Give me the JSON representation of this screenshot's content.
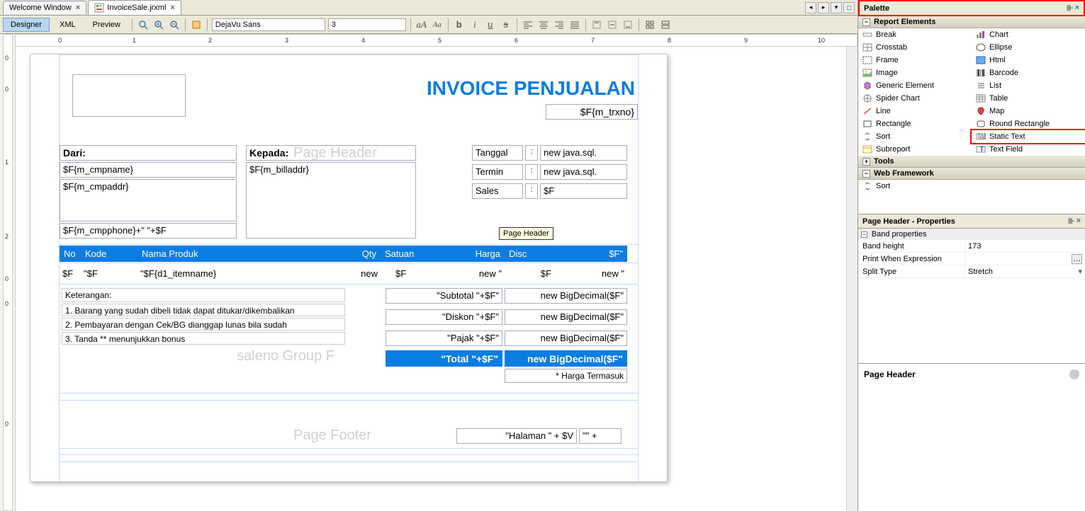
{
  "tabs": {
    "welcome": "Welcome Window",
    "file": "InvoiceSale.jrxml"
  },
  "toolbar": {
    "designer": "Designer",
    "xml": "XML",
    "preview": "Preview",
    "font": "DejaVu Sans",
    "size": "3"
  },
  "ruler": {
    "h": [
      "0",
      "1",
      "2",
      "3",
      "4",
      "5",
      "6",
      "7",
      "8",
      "9",
      "10"
    ],
    "v": [
      "0",
      "0",
      "1",
      "2",
      "0",
      "0",
      "0"
    ]
  },
  "report": {
    "title": "INVOICE PENJUALAN",
    "trxno": "$F{m_trxno}",
    "dari": "Dari:",
    "kepada": "Kepada:",
    "cmpname": "$F{m_cmpname}",
    "cmpaddr": "$F{m_cmpaddr}",
    "cmpphone": "$F{m_cmpphone}+\" \"+$F",
    "billaddr": "$F{m_billaddr}",
    "meta": {
      "tanggal_l": "Tanggal",
      "tanggal_v": "new java.sql.",
      "termin_l": "Termin",
      "termin_v": "new java.sql.",
      "sales_l": "Sales",
      "sales_v": "$F",
      "colon": ":"
    },
    "cols": {
      "no": "No",
      "kode": "Kode",
      "nama": "Nama Produk",
      "qty": "Qty",
      "satuan": "Satuan",
      "harga": "Harga",
      "disc": "Disc",
      "end": "$F\""
    },
    "row": {
      "no": "$F",
      "kode": "\"$F",
      "nama": "\"$F{d1_itemname}",
      "qty": "new",
      "satuan": "$F",
      "harga": "new \"",
      "disc": "$F",
      "end": "new \""
    },
    "keterangan": "Keterangan:",
    "notes": [
      "1. Barang yang sudah dibeli tidak dapat ditukar/dikembalikan",
      "2. Pembayaran dengan Cek/BG dianggap lunas bila sudah",
      "3. Tanda ** menunjukkan bonus"
    ],
    "sums": {
      "subtotal_l": "\"Subtotal \"+$F\"",
      "subtotal_v": "new BigDecimal($F\"",
      "diskon_l": "\"Diskon \"+$F\"",
      "diskon_v": "new BigDecimal($F\"",
      "pajak_l": "\"Pajak \"+$F\"",
      "pajak_v": "new BigDecimal($F\"",
      "total_l": "\"Total \"+$F\"",
      "total_v": "new BigDecimal($F\""
    },
    "tax_note": "* Harga Termasuk",
    "footer_group": "saleno Group F",
    "page_header_band": "Page Header",
    "page_footer_band": "Page Footer",
    "halaman": "\"Halaman \" + $V",
    "halaman2": "\"\" +",
    "tooltip": "Page Header"
  },
  "palette": {
    "title": "Palette",
    "sections": {
      "report_elements": "Report Elements",
      "tools": "Tools",
      "web": "Web Framework"
    },
    "items_left": [
      "Break",
      "Crosstab",
      "Frame",
      "Image",
      "Generic Element",
      "Spider Chart",
      "Line",
      "Rectangle",
      "Sort",
      "Subreport"
    ],
    "items_right": [
      "Chart",
      "Ellipse",
      "Html",
      "Barcode",
      "List",
      "Table",
      "Map",
      "Round Rectangle",
      "Static Text",
      "Text Field"
    ],
    "web_item": "Sort"
  },
  "properties": {
    "title": "Page Header - Properties",
    "cat": "Band properties",
    "rows": {
      "band_height_k": "Band height",
      "band_height_v": "173",
      "print_when_k": "Print When Expression",
      "print_when_v": "",
      "split_k": "Split Type",
      "split_v": "Stretch"
    }
  },
  "help": {
    "title": "Page Header"
  }
}
